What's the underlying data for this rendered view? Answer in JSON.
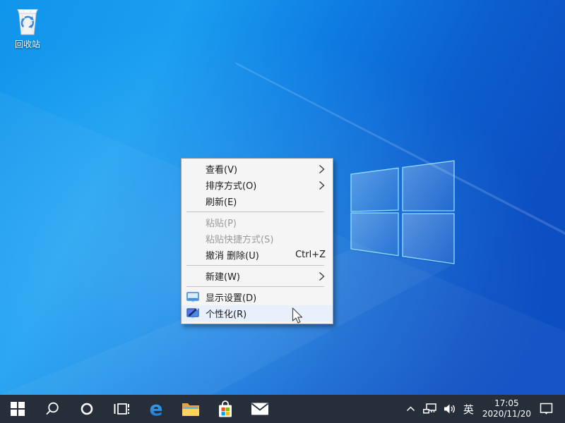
{
  "desktop": {
    "recycle_bin_label": "回收站"
  },
  "context_menu": {
    "items": [
      {
        "label": "查看(V)",
        "has_submenu": true
      },
      {
        "label": "排序方式(O)",
        "has_submenu": true
      },
      {
        "label": "刷新(E)"
      },
      {
        "label": "粘贴(P)",
        "disabled": true
      },
      {
        "label": "粘贴快捷方式(S)",
        "disabled": true
      },
      {
        "label": "撤消 删除(U)",
        "shortcut": "Ctrl+Z"
      },
      {
        "label": "新建(W)",
        "has_submenu": true
      },
      {
        "label": "显示设置(D)",
        "icon": "display-settings-icon"
      },
      {
        "label": "个性化(R)",
        "icon": "personalization-icon",
        "highlighted": true
      }
    ]
  },
  "taskbar": {
    "buttons": [
      {
        "icon": "start-icon"
      },
      {
        "icon": "search-icon"
      },
      {
        "icon": "cortana-icon"
      },
      {
        "icon": "task-view-icon"
      },
      {
        "icon": "edge-icon",
        "glyph": "e"
      },
      {
        "icon": "file-explorer-icon"
      },
      {
        "icon": "store-icon"
      },
      {
        "icon": "mail-icon"
      }
    ],
    "tray": {
      "ime_label": "英",
      "time": "17:05",
      "date": "2020/11/20"
    }
  },
  "colors": {
    "desktop_gradient_left": "#14a0f0",
    "desktop_gradient_right": "#0c4fc3",
    "taskbar_bg": "#252e39",
    "menu_bg": "#f5f5f5",
    "menu_highlight": "#e8f1fb",
    "menu_disabled_text": "#9b9b9b",
    "store_red": "#f25022",
    "store_green": "#7fba00",
    "store_blue": "#00a4ef",
    "store_yellow": "#ffb900",
    "folder_yellow": "#ffd35e",
    "edge_blue": "#2ea2e8"
  }
}
